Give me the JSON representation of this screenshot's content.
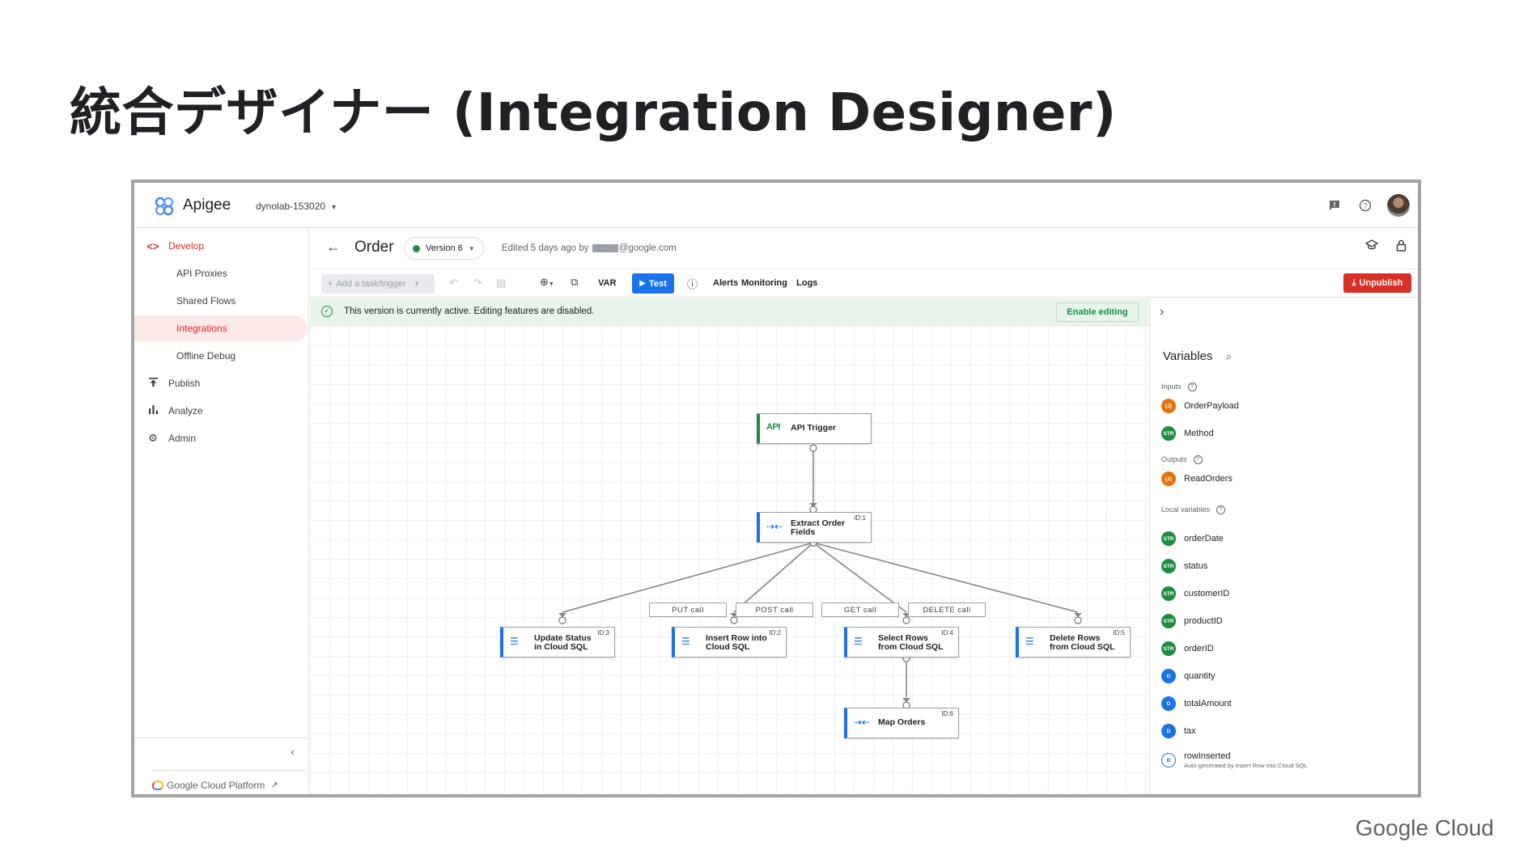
{
  "slide": {
    "title": "統合デザイナー (Integration Designer)",
    "footer_brand": "Google Cloud"
  },
  "app": {
    "name": "Apigee",
    "project": "dynolab-153020"
  },
  "sidebar": {
    "items": [
      {
        "label": "Develop",
        "icon": "code-brackets-icon"
      },
      {
        "label": "API Proxies"
      },
      {
        "label": "Shared Flows"
      },
      {
        "label": "Integrations"
      },
      {
        "label": "Offline Debug"
      },
      {
        "label": "Publish",
        "icon": "publish-icon"
      },
      {
        "label": "Analyze",
        "icon": "bar-chart-icon"
      },
      {
        "label": "Admin",
        "icon": "gear-icon"
      }
    ],
    "footer_link": "Google Cloud Platform"
  },
  "integration": {
    "name": "Order",
    "version": "Version 6",
    "edited_prefix": "Edited 5 days ago by",
    "edited_suffix": "@google.com"
  },
  "toolbar": {
    "add_task": "Add a task/trigger",
    "var": "VAR",
    "test": "Test",
    "alerts": "Alerts",
    "monitoring": "Monitoring",
    "logs": "Logs",
    "unpublish": "Unpublish"
  },
  "banner": {
    "text": "This version is currently active. Editing features are disabled.",
    "action": "Enable editing"
  },
  "flow": {
    "nodes": [
      {
        "label": "API Trigger",
        "id": "",
        "icon": "API"
      },
      {
        "label": "Extract Order\nFields",
        "id": "ID:1"
      },
      {
        "label": "Update Status\nin Cloud SQL",
        "id": "ID:3"
      },
      {
        "label": "Insert Row into\nCloud SQL",
        "id": "ID:2"
      },
      {
        "label": "Select Rows\nfrom Cloud SQL",
        "id": "ID:4"
      },
      {
        "label": "Delete Rows\nfrom Cloud SQL",
        "id": "ID:5"
      },
      {
        "label": "Map Orders",
        "id": "ID:6"
      }
    ],
    "edge_labels": [
      "PUT call",
      "POST call",
      "GET call",
      "DELETE call"
    ]
  },
  "variables": {
    "title": "Variables",
    "inputs_label": "Inputs",
    "outputs_label": "Outputs",
    "local_label": "Local variables",
    "inputs": [
      {
        "type": "{J}",
        "name": "OrderPayload"
      },
      {
        "type": "STR",
        "name": "Method"
      }
    ],
    "outputs": [
      {
        "type": "{J}",
        "name": "ReadOrders"
      }
    ],
    "local": [
      {
        "type": "STR",
        "name": "orderDate"
      },
      {
        "type": "STR",
        "name": "status"
      },
      {
        "type": "STR",
        "name": "customerID"
      },
      {
        "type": "STR",
        "name": "productID"
      },
      {
        "type": "STR",
        "name": "orderID"
      },
      {
        "type": "D",
        "name": "quantity"
      },
      {
        "type": "D",
        "name": "totalAmount"
      },
      {
        "type": "D",
        "name": "tax"
      },
      {
        "type": "B",
        "name": "rowInserted",
        "note": "Auto-generated by Insert Row into Cloud SQL"
      }
    ]
  }
}
